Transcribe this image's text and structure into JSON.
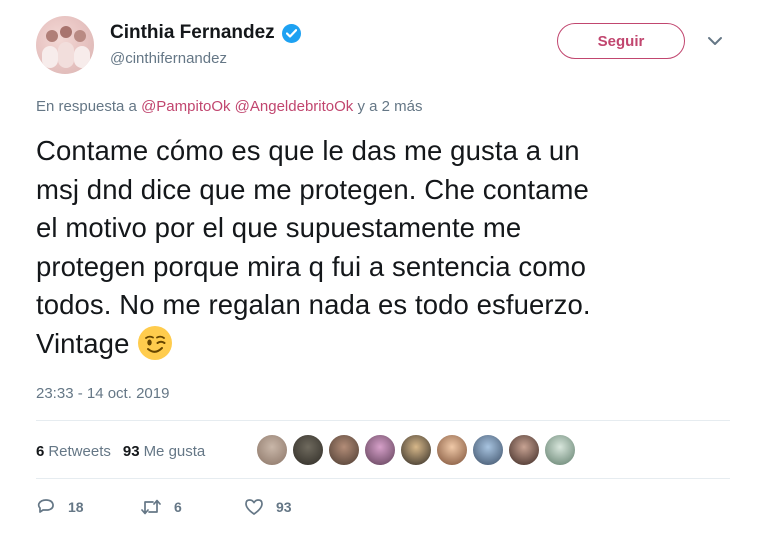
{
  "user": {
    "name": "Cinthia Fernandez",
    "handle": "@cinthifernandez",
    "follow_label": "Seguir"
  },
  "reply": {
    "prefix": "En respuesta a",
    "mention1": "@PampitoOk",
    "mention2": "@AngeldebritoOk",
    "suffix": "y a 2 más"
  },
  "tweet": {
    "lines": [
      "Contame cómo es que le das me gusta a un",
      "msj dnd dice que me protegen. Che contame",
      "el motivo por el que supuestamente me",
      "protegen porque mira q fui a sentencia como",
      "todos. No me regalan nada es todo esfuerzo.",
      "Vintage"
    ],
    "emoji": "winking-face",
    "timestamp": "23:33 - 14 oct. 2019"
  },
  "stats": {
    "retweets_count": "6",
    "retweets_label": "Retweets",
    "likes_count": "93",
    "likes_label": "Me gusta"
  },
  "actions": {
    "replies": "18",
    "retweets": "6",
    "likes": "93"
  },
  "colors": {
    "accent": "#c1466f",
    "verified": "#1da1f2",
    "muted": "#657786"
  }
}
